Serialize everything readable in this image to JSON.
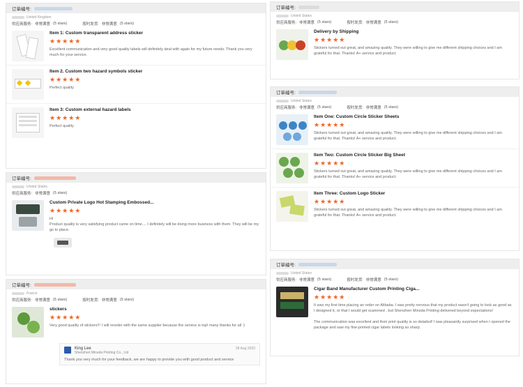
{
  "labels": {
    "order_no": "订单编号:",
    "supplier_service": "供应商服务:",
    "ontime": "按时发货:",
    "very_satisfied": "非常满意",
    "five_stars": "(5 stars)",
    "stars": "★★★★★"
  },
  "left": {
    "orders": [
      {
        "buyer_country": "United Kingdom",
        "items": [
          {
            "title": "Item 1: Custom transparent address sticker",
            "text": "Excellent communication and very good quality labels will definitely deal with again for my future needs. Thank you very much for your service."
          },
          {
            "title": "Item 2. Custom two hazard symbols sticker",
            "text": "Perfect quality"
          },
          {
            "title": "Item 3: Custom external hazard labels",
            "text": "Perfect quality"
          }
        ]
      },
      {
        "buyer_country": "United States",
        "items": [
          {
            "title": "Custom Private Logo Hot Stamping Embossed...",
            "text": "Hi\nProduct quality is very satisfying product came on time.... I definitely will be doing more business with them. They will be my go to place."
          }
        ]
      },
      {
        "buyer_country": "France",
        "items": [
          {
            "title": "stickers",
            "text": "Very good quality of stickers!!! I will reorder with the same supplier because the service is top! many thanks for all :)"
          }
        ],
        "reply": {
          "name": "King Lee",
          "company": "Shenzhen Minsda Printing Co., Ltd",
          "date": "28 Aug 2020",
          "text": "Thank you very much for your feedback,  we are happy to provide you with good product and service"
        }
      }
    ]
  },
  "right": {
    "orders": [
      {
        "buyer_country": "United States",
        "items": [
          {
            "title": "Delivery by Shipping",
            "text": "Stickers turned out great, and amazing quality. They were willing to give me different shipping choices and I am grateful for that. Thanks! A+ service and product."
          }
        ]
      },
      {
        "buyer_country": "United States",
        "items": [
          {
            "title": "Item One: Custom Circle Sticker Sheets",
            "text": "Stickers turned out great, and amazing quality. They were willing to give me different shipping choices and I am grateful for that. Thanks! A+ service and product."
          },
          {
            "title": "Item Two: Custom Circle Sticker Big Sheet",
            "text": "Stickers turned out great, and amazing quality. They were willing to give me different shipping choices and I am grateful for that. Thanks! A+ service and product."
          },
          {
            "title": "Item Three: Custom Logo Sticker",
            "text": "Stickers turned out great, and amazing quality. They were willing to give me different shipping choices and I am grateful for that. Thanks! A+ service and product."
          }
        ]
      },
      {
        "buyer_country": "United States",
        "items": [
          {
            "title": "Cigar Band Manufacturer Custom Printing Ciga...",
            "text": "It was my first time placing an order on Alibaba. I was pretty nervous that my product wasn't going to look as good as I designed it, or that I would get scammed , but Shenzhen Minsda Printing delivered beyond expectations!\n\nThe communication was excellent and their print quality is so detailed! I was pleasantly surprised when I opened the package and saw my fine-printed cigar labels looking so sharp."
          }
        ]
      }
    ]
  }
}
